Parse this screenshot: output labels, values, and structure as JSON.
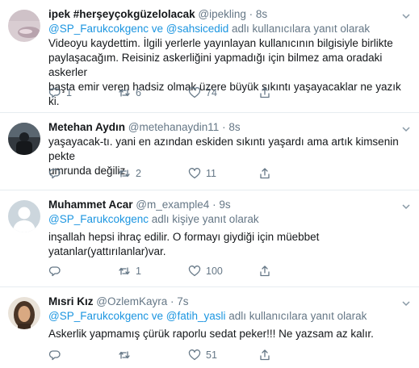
{
  "tweets": [
    {
      "name": "ipek #herşeyçokgüzelolacak",
      "handle": "@ipekling",
      "dot": "·",
      "time": "8s",
      "reply_mentions": "@SP_Farukcokgenc ve @sahsicedid",
      "reply_suffix": " adlı kullanıcılara yanıt olarak",
      "text_lines": [
        "Videoyu kaydettim. İlgili yerlerle yayınlayan kullanıcının bilgisiyle birlikte",
        "paylaşacağım. Reisiniz askerliğini yapmadığı için bilmez ama oradaki askerler",
        "başta emir veren hadsiz olmak üzere büyük sıkıntı yaşayacaklar ne yazık ki."
      ],
      "replies": "1",
      "retweets": "6",
      "likes": "74"
    },
    {
      "name": "Metehan Aydın",
      "handle": "@metehanaydin11",
      "dot": "·",
      "time": "8s",
      "text_lines": [
        "yaşayacak-tı. yani en azından eskiden sıkıntı yaşardı ama artık kimsenin pekte",
        "umrunda değiliz"
      ],
      "replies": "",
      "retweets": "2",
      "likes": "11"
    },
    {
      "name": "Muhammet Acar",
      "handle": "@m_example4",
      "dot": "·",
      "time": "9s",
      "reply_mentions": "@SP_Farukcokgenc",
      "reply_suffix": " adlı kişiye yanıt olarak",
      "text_lines": [
        "inşallah hepsi ihraç edilir. O formayı giydiği için müebbet",
        "yatanlar(yattırılanlar)var."
      ],
      "replies": "",
      "retweets": "1",
      "likes": "100"
    },
    {
      "name": "Mısri Kız",
      "handle": "@OzlemKayra",
      "dot": "·",
      "time": "7s",
      "reply_mentions": "@SP_Farukcokgenc ve @fatih_yasli",
      "reply_suffix": " adlı kullanıcılara yanıt olarak",
      "text_lines": [
        "Askerlik yapmamış çürük raporlu sedat peker!!! Ne yazsam az kalır."
      ],
      "replies": "",
      "retweets": "",
      "likes": "51"
    }
  ],
  "icons": {
    "reply": "reply-icon",
    "retweet": "retweet-icon",
    "like": "heart-icon",
    "share": "share-icon",
    "more": "chevron-down-icon"
  },
  "colors": {
    "link": "#1b95e0",
    "secondary": "#657786",
    "text": "#14171a",
    "divider": "#e6ecf0"
  }
}
